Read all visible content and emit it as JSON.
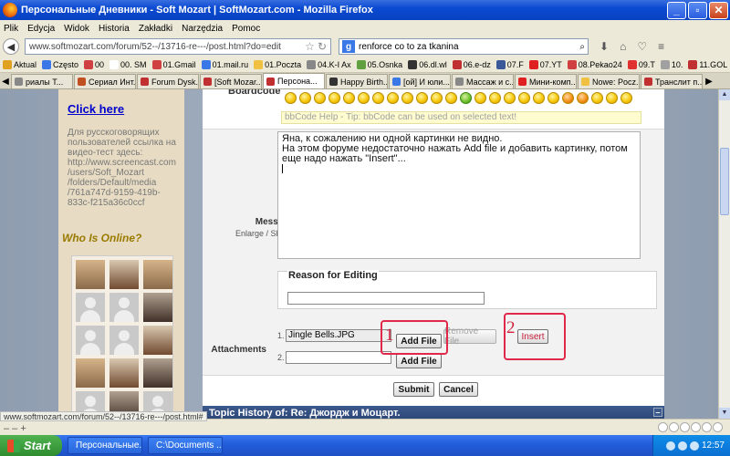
{
  "window": {
    "title": "Персональные Дневники - Soft Mozart | SoftMozart.com - Mozilla Firefox"
  },
  "menu": [
    "Plik",
    "Edycja",
    "Widok",
    "Historia",
    "Zakładki",
    "Narzędzia",
    "Pomoc"
  ],
  "nav": {
    "url": "www.softmozart.com/forum/52--/13716-re---/post.html?do=edit",
    "search": "renforce co to za tkanina"
  },
  "bookmarks": [
    {
      "label": "Aktual",
      "color": "#e0a020"
    },
    {
      "label": "Często",
      "color": "#3a78e8"
    },
    {
      "label": "00",
      "color": "#d04040"
    },
    {
      "label": "00. SM",
      "color": "#ffffff"
    },
    {
      "label": "01.Gmail",
      "color": "#d04040"
    },
    {
      "label": "01.mail.ru",
      "color": "#3a78e8"
    },
    {
      "label": "01.Poczta",
      "color": "#f0c040"
    },
    {
      "label": "04.K-I Ax",
      "color": "#888888"
    },
    {
      "label": "05.Osnka",
      "color": "#60a040"
    },
    {
      "label": "06.dl.wl",
      "color": "#333333"
    },
    {
      "label": "06.e-dz",
      "color": "#c03030"
    },
    {
      "label": "07.F",
      "color": "#3b5998"
    },
    {
      "label": "07.YT",
      "color": "#e02020"
    },
    {
      "label": "08.Pekao24",
      "color": "#d04040"
    },
    {
      "label": "09.T",
      "color": "#e03030"
    },
    {
      "label": "10.",
      "color": "#a0a0a0"
    },
    {
      "label": "11.GOL",
      "color": "#c03030"
    }
  ],
  "tabs": [
    {
      "label": "риалы Т...",
      "color": "#888"
    },
    {
      "label": "Сериал Инт...",
      "color": "#c05020"
    },
    {
      "label": "Forum Dysk...",
      "color": "#c03030"
    },
    {
      "label": "[Soft Mozar...",
      "color": "#c03030"
    },
    {
      "label": "Персона...",
      "color": "#c03030",
      "active": true
    },
    {
      "label": "Happy Birth...",
      "color": "#333"
    },
    {
      "label": "[ой] И юли...",
      "color": "#3a78e8"
    },
    {
      "label": "Массаж и с...",
      "color": "#888"
    },
    {
      "label": "Мини-комп...",
      "color": "#e02020"
    },
    {
      "label": "Nowe: Pocz...",
      "color": "#f0c040"
    },
    {
      "label": "Транслит п...",
      "color": "#c03030"
    }
  ],
  "sidebar": {
    "click_here": "Click here",
    "ru_text": "Для русскоговорящих пользователей ссылка на видео-тест здесь: http://www.screencast.com /users/Soft_Mozart /folders/Default/media /761a747d-9159-419b- 833c-f215a36c0ccf",
    "who_online": "Who Is Online?",
    "avatars": [
      "ph",
      "ph2",
      "ph",
      "sil",
      "sil",
      "ph3",
      "sil",
      "sil",
      "ph2",
      "ph",
      "ph2",
      "ph3",
      "sil",
      "ph3",
      "sil",
      "sil",
      "ph3",
      "sil"
    ]
  },
  "form": {
    "boardcode_label": "Boardcode",
    "bbhelp": "bbCode Help - Tip: bbCode can be used on selected text!",
    "message_label": "Message",
    "message_sub": "Enlarge / Shrink",
    "message_lines": [
      "Яна, к сожалению ни одной картинки не видно.",
      "На этом форуме недостаточно нажать Add file и добавить картинку, потом",
      "еще надо нажать \"Insert\"..."
    ],
    "reason_title": "Reason for Editing",
    "attachments_label": "Attachments",
    "attach1_num": "1.",
    "attach1_value": "Jingle Bells.JPG",
    "attach2_num": "2.",
    "add_file": "Add File",
    "remove_file": "Remove File",
    "insert": "Insert",
    "callout1": "1",
    "callout2": "2",
    "submit": "Submit",
    "cancel": "Cancel"
  },
  "topic_history": "Topic History of: Re: Джордж и Моцарт.",
  "status": {
    "url": "www.softmozart.com/forum/52--/13716-re---/post.html#"
  },
  "taskbar": {
    "start": "Start",
    "tasks": [
      "Персональные...",
      "C:\\Documents ..."
    ],
    "clock": "12:57"
  }
}
